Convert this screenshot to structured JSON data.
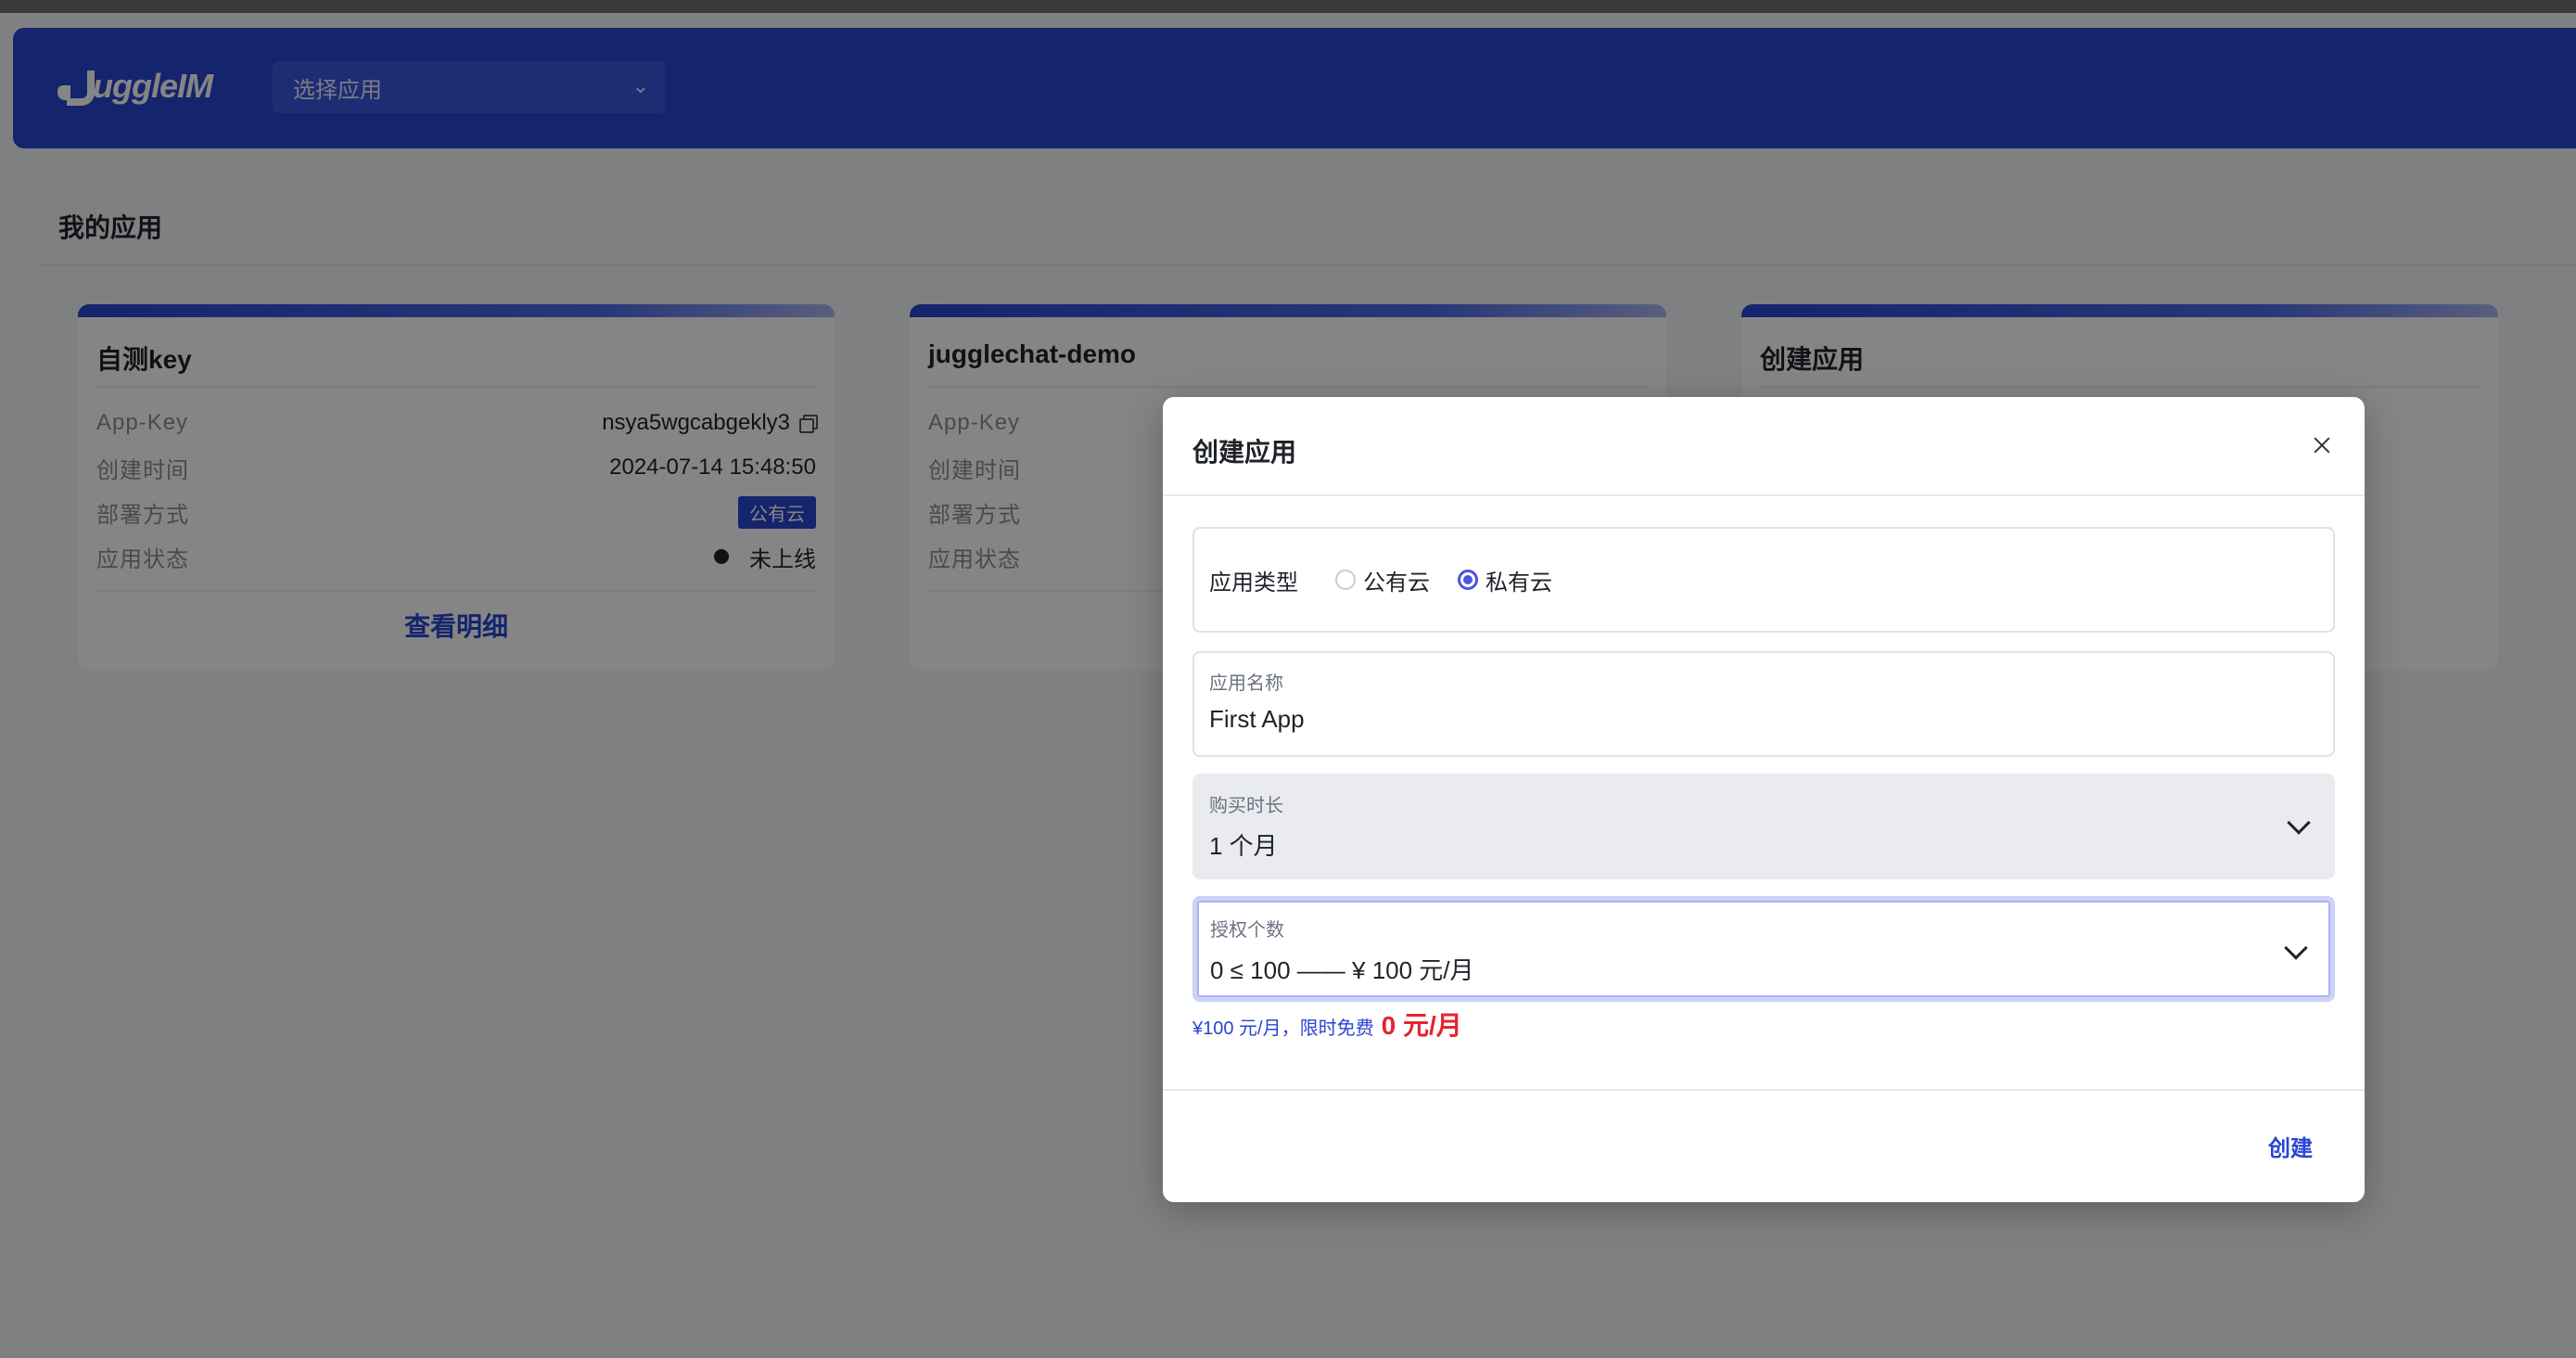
{
  "header": {
    "logo_text": "uggleIM",
    "app_select_placeholder": "选择应用"
  },
  "page": {
    "section_title": "我的应用"
  },
  "cards": [
    {
      "title": "自测key",
      "rows": [
        {
          "label": "App-Key",
          "value": "nsya5wgcabgekly3"
        },
        {
          "label": "创建时间",
          "value": "2024-07-14 15:48:50"
        },
        {
          "label": "部署方式",
          "value": "公有云"
        },
        {
          "label": "应用状态",
          "value": "未上线"
        }
      ],
      "link": "查看明细"
    },
    {
      "title": "jugglechat-demo",
      "rows": [
        {
          "label": "App-Key"
        },
        {
          "label": "创建时间"
        },
        {
          "label": "部署方式"
        },
        {
          "label": "应用状态"
        }
      ]
    },
    {
      "title": "创建应用"
    }
  ],
  "modal": {
    "title": "创建应用",
    "app_type": {
      "label": "应用类型",
      "options": [
        "公有云",
        "私有云"
      ],
      "selected": "私有云"
    },
    "app_name": {
      "label": "应用名称",
      "value": "First App"
    },
    "duration": {
      "label": "购买时长",
      "value": "1 个月"
    },
    "license": {
      "label": "授权个数",
      "value": "0 ≤ 100 —— ¥ 100 元/月"
    },
    "price_note": "¥100 元/月，限时免费",
    "price_free": "0 元/月",
    "create_label": "创建"
  }
}
